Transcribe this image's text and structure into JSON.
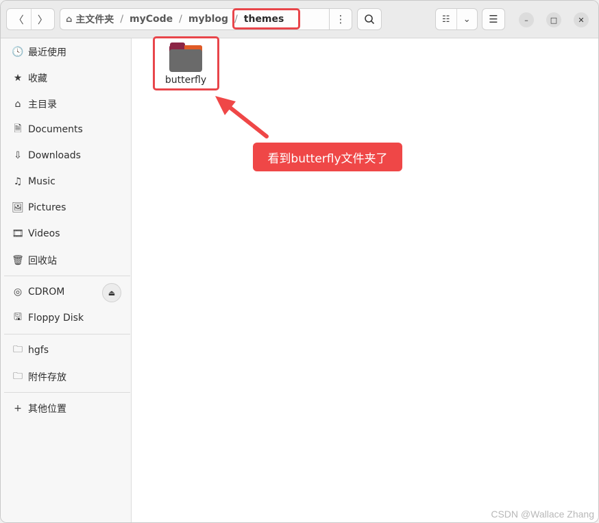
{
  "headerbar": {
    "back_icon": "〈",
    "forward_icon": "〉",
    "path": {
      "home_label": "主文件夹",
      "segments": [
        "myCode",
        "myblog",
        "themes"
      ],
      "separator": "/"
    },
    "path_menu_icon": "⋮",
    "search_icon": "⌕",
    "view_list_icon": "☷",
    "view_dropdown_icon": "⌄",
    "menu_icon": "☰",
    "minimize_icon": "–",
    "maximize_icon": "□",
    "close_icon": "✕"
  },
  "sidebar": {
    "items": [
      {
        "label": "最近使用",
        "icon": "🕓"
      },
      {
        "label": "收藏",
        "icon": "★"
      },
      {
        "label": "主目录",
        "icon": "⌂"
      },
      {
        "label": "Documents",
        "icon": "🗎"
      },
      {
        "label": "Downloads",
        "icon": "⇩"
      },
      {
        "label": "Music",
        "icon": "♫"
      },
      {
        "label": "Pictures",
        "icon": "🖼"
      },
      {
        "label": "Videos",
        "icon": "🎞"
      },
      {
        "label": "回收站",
        "icon": "🗑"
      }
    ],
    "devices": [
      {
        "label": "CDROM",
        "icon": "◎"
      },
      {
        "label": "Floppy Disk",
        "icon": "🖫"
      }
    ],
    "mounts": [
      {
        "label": "hgfs",
        "icon": "🗀"
      },
      {
        "label": "附件存放",
        "icon": "🗀"
      }
    ],
    "other": {
      "label": "其他位置",
      "icon": "+"
    },
    "eject_icon": "⏏"
  },
  "content": {
    "folders": [
      {
        "name": "butterfly"
      }
    ],
    "annotation": "看到butterfly文件夹了"
  },
  "watermark": "CSDN @Wallace Zhang",
  "colors": {
    "highlight": "#e8454a",
    "annotation_bg": "#ef4747",
    "folder_top": "#8b2545",
    "folder_accent": "#e05a25",
    "folder_body": "#6a6a6a"
  }
}
